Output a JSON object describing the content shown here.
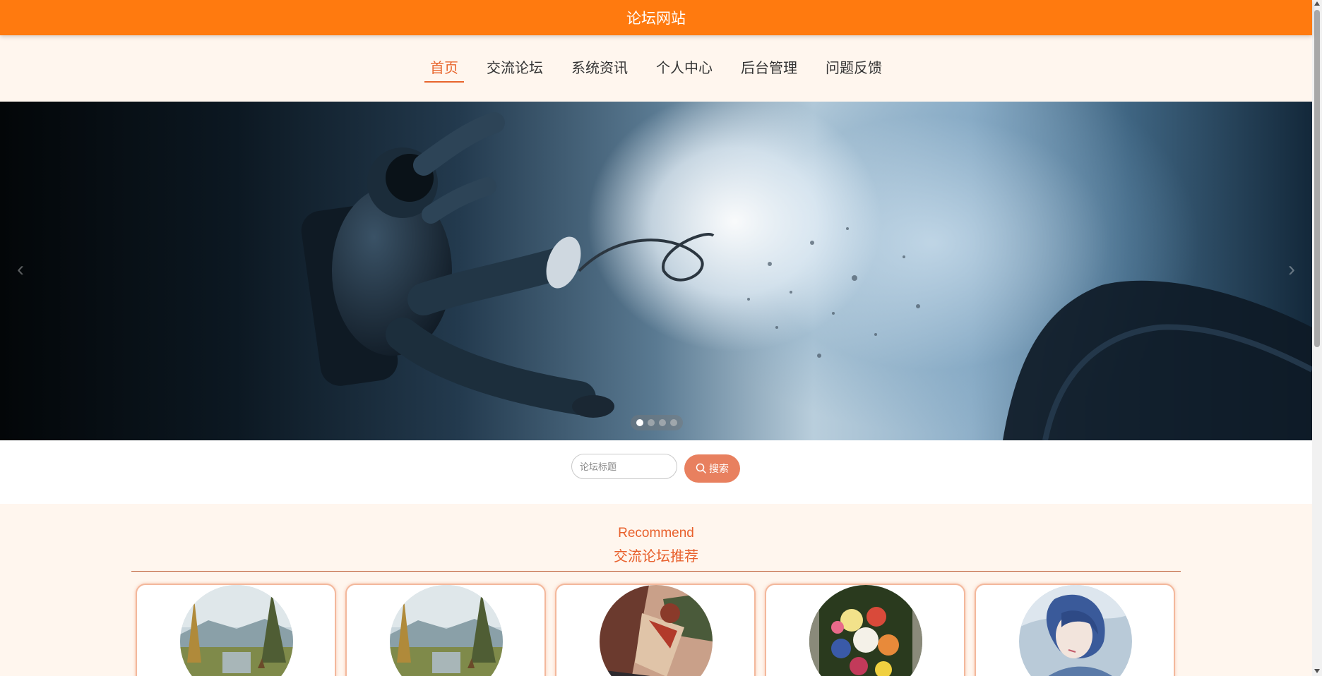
{
  "header": {
    "title": "论坛网站"
  },
  "nav": {
    "items": [
      {
        "label": "首页",
        "active": true
      },
      {
        "label": "交流论坛",
        "active": false
      },
      {
        "label": "系统资讯",
        "active": false
      },
      {
        "label": "个人中心",
        "active": false
      },
      {
        "label": "后台管理",
        "active": false
      },
      {
        "label": "问题反馈",
        "active": false
      }
    ]
  },
  "banner": {
    "image": "astronaut-floating-in-space",
    "slide_count": 4,
    "active_slide": 1,
    "prev_icon": "chevron-left-icon",
    "next_icon": "chevron-right-icon"
  },
  "search": {
    "placeholder": "论坛标题",
    "value": "",
    "button_label": "搜索",
    "button_icon": "search-icon"
  },
  "recommend": {
    "title_en": "Recommend",
    "title_zh": "交流论坛推荐",
    "cards": [
      {
        "image": "landscape-deer-painting"
      },
      {
        "image": "landscape-deer-painting"
      },
      {
        "image": "anime-action-illustration"
      },
      {
        "image": "flower-bouquet-painting"
      },
      {
        "image": "anime-portrait-blue-hair"
      }
    ]
  },
  "colors": {
    "topbar": "#ff7a0f",
    "accent": "#e8652c",
    "search_button": "#e8805f",
    "section_bg": "#fff6ee"
  }
}
